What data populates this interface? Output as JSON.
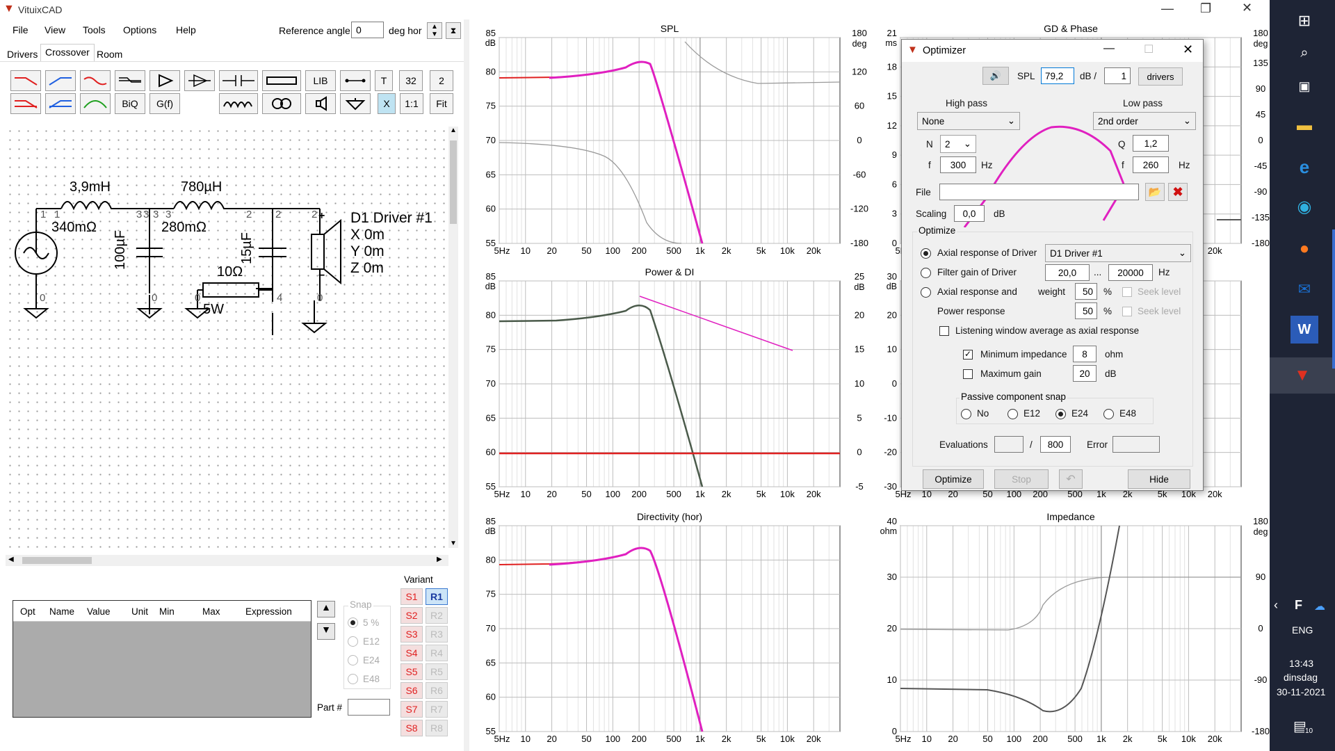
{
  "app": {
    "title": "VituixCAD"
  },
  "menu": [
    "File",
    "View",
    "Tools",
    "Options",
    "Help"
  ],
  "reference": {
    "label": "Reference angle",
    "value": "0",
    "unit": "deg hor"
  },
  "tabs": [
    "Drivers",
    "Crossover",
    "Room"
  ],
  "toolbar": {
    "lib": "LIB",
    "t": "T",
    "n32": "32",
    "n2": "2",
    "biq": "BiQ",
    "gf": "G(f)",
    "x": "X",
    "ratio": "1:1",
    "fit": "Fit"
  },
  "schematic": {
    "l1": "3,9mH",
    "l1r": "340mΩ",
    "l2": "780µH",
    "l2r": "280mΩ",
    "c1": "100µF",
    "c2": "15µF",
    "r1": "10Ω",
    "r1p": "5W",
    "driver": [
      "D1 Driver #1",
      "X 0m",
      "Y 0m",
      "Z 0m"
    ],
    "nodes": [
      "1",
      "1",
      "3",
      "3",
      "3",
      "3",
      "2",
      "2",
      "2",
      "3",
      "0",
      "0",
      "0",
      "4",
      "0"
    ]
  },
  "table": {
    "headers": [
      "Opt",
      "Name",
      "Value",
      "Unit",
      "Min",
      "Max",
      "Expression"
    ]
  },
  "snap": {
    "title": "Snap",
    "options": [
      "5 %",
      "E12",
      "E24",
      "E48"
    ],
    "part_label": "Part #"
  },
  "variant": {
    "title": "Variant",
    "s": [
      "S1",
      "S2",
      "S3",
      "S4",
      "S5",
      "S6",
      "S7",
      "S8"
    ],
    "r": [
      "R1",
      "R2",
      "R3",
      "R4",
      "R5",
      "R6",
      "R7",
      "R8"
    ]
  },
  "graphs": {
    "spl": {
      "title": "SPL",
      "yunit": "dB",
      "y2unit": "deg",
      "yticks": [
        "85",
        "80",
        "75",
        "70",
        "65",
        "60",
        "55"
      ],
      "y2ticks": [
        "180",
        "120",
        "60",
        "0",
        "-60",
        "-120",
        "-180"
      ]
    },
    "power": {
      "title": "Power & DI",
      "yunit": "dB",
      "y2unit": "dB",
      "yticks": [
        "85",
        "80",
        "75",
        "70",
        "65",
        "60",
        "55"
      ],
      "y2ticks": [
        "25",
        "20",
        "15",
        "10",
        "5",
        "0",
        "-5"
      ]
    },
    "directivity": {
      "title": "Directivity (hor)",
      "yunit": "dB",
      "yticks": [
        "85",
        "80",
        "75",
        "70",
        "65",
        "60",
        "55"
      ]
    },
    "gd": {
      "title": "GD & Phase",
      "yunit": "ms",
      "y2unit": "deg",
      "yticks": [
        "21",
        "18",
        "15",
        "12",
        "9",
        "6",
        "3",
        "0"
      ],
      "y2ticks": [
        "180",
        "135",
        "90",
        "45",
        "0",
        "-45",
        "-90",
        "-135",
        "-180"
      ]
    },
    "mid": {
      "yunit": "dB",
      "yticks": [
        "30",
        "20",
        "10",
        "0",
        "-10",
        "-20",
        "-30"
      ]
    },
    "impedance": {
      "title": "Impedance",
      "yunit": "ohm",
      "y2unit": "deg",
      "yticks": [
        "40",
        "30",
        "20",
        "10",
        "0"
      ],
      "y2ticks": [
        "180",
        "90",
        "0",
        "-90",
        "-180"
      ]
    },
    "xticks": [
      "5Hz",
      "10",
      "20",
      "50",
      "100",
      "200",
      "500",
      "1k",
      "2k",
      "5k",
      "10k",
      "20k"
    ]
  },
  "optimizer": {
    "title": "Optimizer",
    "spl_label": "SPL",
    "spl_value": "79,2",
    "db_per": "dB /",
    "drivers_count": "1",
    "drivers_btn": "drivers",
    "hp_label": "High pass",
    "hp_type": "None",
    "lp_label": "Low pass",
    "lp_type": "2nd order",
    "n_label": "N",
    "n_value": "2",
    "q_label": "Q",
    "q_value": "1,2",
    "f_label": "f",
    "hp_f": "300",
    "lp_f": "260",
    "hz": "Hz",
    "file_label": "File",
    "scaling_label": "Scaling",
    "scaling_value": "0,0",
    "scaling_unit": "dB",
    "optimize_group": "Optimize",
    "opt1": "Axial response of Driver",
    "opt1_driver": "D1 Driver #1",
    "opt2": "Filter gain of Driver",
    "opt2_from": "20,0",
    "opt2_dots": "...",
    "opt2_to": "20000",
    "opt2_unit": "Hz",
    "opt3": "Axial response and",
    "weight_label": "weight",
    "weight1": "50",
    "weight2": "50",
    "pct": "%",
    "seek": "Seek level",
    "power_resp": "Power response",
    "listening": "Listening window average as axial response",
    "min_imp": "Minimum impedance",
    "min_imp_val": "8",
    "ohm": "ohm",
    "max_gain": "Maximum gain",
    "max_gain_val": "20",
    "db": "dB",
    "snap_label": "Passive component snap",
    "snap_opts": [
      "No",
      "E12",
      "E24",
      "E48"
    ],
    "eval_label": "Evaluations",
    "eval_slash": "/",
    "eval_max": "800",
    "error_label": "Error",
    "btn_optimize": "Optimize",
    "btn_stop": "Stop",
    "btn_hide": "Hide"
  },
  "tray": {
    "lang": "ENG",
    "time": "13:43",
    "day": "dinsdag",
    "date": "30-11-2021",
    "notif": "10"
  },
  "colors": {
    "accent": "#e020c0",
    "red": "#e02020",
    "gray": "#9a9a9a"
  }
}
